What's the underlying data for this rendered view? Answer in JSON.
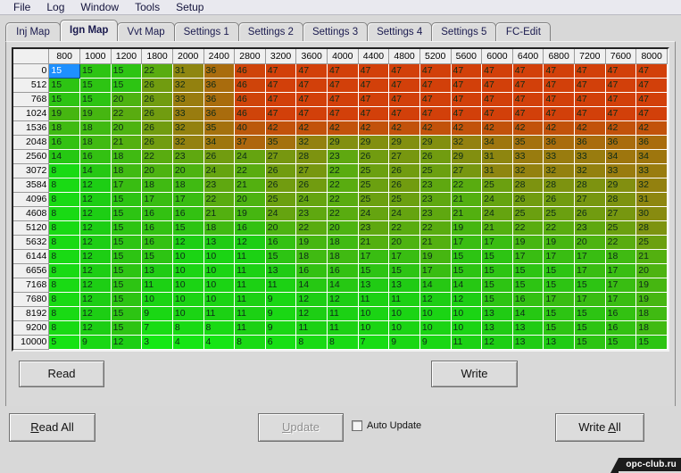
{
  "menu": {
    "items": [
      "File",
      "Log",
      "Window",
      "Tools",
      "Setup"
    ]
  },
  "tabs": [
    {
      "label": "Inj Map",
      "active": false
    },
    {
      "label": "Ign Map",
      "active": true
    },
    {
      "label": "Vvt Map",
      "active": false
    },
    {
      "label": "Settings 1",
      "active": false
    },
    {
      "label": "Settings 2",
      "active": false
    },
    {
      "label": "Settings 3",
      "active": false
    },
    {
      "label": "Settings 4",
      "active": false
    },
    {
      "label": "Settings 5",
      "active": false
    },
    {
      "label": "FC-Edit",
      "active": false
    }
  ],
  "colors": {
    "selection": "#1e90ff",
    "selection_text": "#ffffff",
    "low": "#00e000",
    "mid": "#8a8a10",
    "high": "#d2400a",
    "panel": "#d9d9d9"
  },
  "grid": {
    "corner_label": "",
    "column_headers": [
      "800",
      "1000",
      "1200",
      "1800",
      "2000",
      "2400",
      "2800",
      "3200",
      "3600",
      "4000",
      "4400",
      "4800",
      "5200",
      "5600",
      "6000",
      "6400",
      "6800",
      "7200",
      "7600",
      "8000"
    ],
    "row_headers": [
      "0",
      "512",
      "768",
      "1024",
      "1536",
      "2048",
      "2560",
      "3072",
      "3584",
      "4096",
      "4608",
      "5120",
      "5632",
      "6144",
      "6656",
      "7168",
      "7680",
      "8192",
      "9200",
      "10000"
    ],
    "selected_cell": {
      "row": 0,
      "col": 0,
      "value": "15"
    },
    "values": [
      [
        15,
        15,
        15,
        22,
        31,
        36,
        46,
        47,
        47,
        47,
        47,
        47,
        47,
        47,
        47,
        47,
        47,
        47,
        47,
        47
      ],
      [
        15,
        15,
        15,
        26,
        32,
        36,
        46,
        47,
        47,
        47,
        47,
        47,
        47,
        47,
        47,
        47,
        47,
        47,
        47,
        47
      ],
      [
        15,
        15,
        20,
        26,
        33,
        36,
        46,
        47,
        47,
        47,
        47,
        47,
        47,
        47,
        47,
        47,
        47,
        47,
        47,
        47
      ],
      [
        19,
        19,
        22,
        26,
        33,
        36,
        46,
        47,
        47,
        47,
        47,
        47,
        47,
        47,
        47,
        47,
        47,
        47,
        47,
        47
      ],
      [
        18,
        18,
        20,
        26,
        32,
        35,
        40,
        42,
        42,
        42,
        42,
        42,
        42,
        42,
        42,
        42,
        42,
        42,
        42,
        42
      ],
      [
        16,
        18,
        21,
        26,
        32,
        34,
        37,
        35,
        32,
        29,
        29,
        29,
        29,
        32,
        34,
        35,
        36,
        36,
        36,
        36
      ],
      [
        14,
        16,
        18,
        22,
        23,
        26,
        24,
        27,
        28,
        23,
        26,
        27,
        26,
        29,
        31,
        33,
        33,
        33,
        34,
        34
      ],
      [
        8,
        14,
        18,
        20,
        20,
        24,
        22,
        26,
        27,
        22,
        25,
        26,
        25,
        27,
        31,
        32,
        32,
        32,
        33,
        33
      ],
      [
        8,
        12,
        17,
        18,
        18,
        23,
        21,
        26,
        26,
        22,
        25,
        26,
        23,
        22,
        25,
        28,
        28,
        28,
        29,
        32
      ],
      [
        8,
        12,
        15,
        17,
        17,
        22,
        20,
        25,
        24,
        22,
        25,
        25,
        23,
        21,
        24,
        26,
        26,
        27,
        28,
        31
      ],
      [
        8,
        12,
        15,
        16,
        16,
        21,
        19,
        24,
        23,
        22,
        24,
        24,
        23,
        21,
        24,
        25,
        25,
        26,
        27,
        30
      ],
      [
        8,
        12,
        15,
        16,
        15,
        18,
        16,
        20,
        22,
        20,
        23,
        22,
        22,
        19,
        21,
        22,
        22,
        23,
        25,
        28
      ],
      [
        8,
        12,
        15,
        16,
        12,
        13,
        12,
        16,
        19,
        18,
        21,
        20,
        21,
        17,
        17,
        19,
        19,
        20,
        22,
        25
      ],
      [
        8,
        12,
        15,
        15,
        10,
        10,
        11,
        15,
        18,
        18,
        17,
        17,
        19,
        15,
        15,
        17,
        17,
        17,
        18,
        21
      ],
      [
        8,
        12,
        15,
        13,
        10,
        10,
        11,
        13,
        16,
        16,
        15,
        15,
        17,
        15,
        15,
        15,
        15,
        17,
        17,
        20
      ],
      [
        8,
        12,
        15,
        11,
        10,
        10,
        11,
        11,
        14,
        14,
        13,
        13,
        14,
        14,
        15,
        15,
        15,
        15,
        17,
        19
      ],
      [
        8,
        12,
        15,
        10,
        10,
        10,
        11,
        9,
        12,
        12,
        11,
        11,
        12,
        12,
        15,
        16,
        17,
        17,
        17,
        19
      ],
      [
        8,
        12,
        15,
        9,
        10,
        11,
        11,
        9,
        12,
        11,
        10,
        10,
        10,
        10,
        13,
        14,
        15,
        15,
        16,
        18
      ],
      [
        8,
        12,
        15,
        7,
        8,
        8,
        11,
        9,
        11,
        11,
        10,
        10,
        10,
        10,
        13,
        13,
        15,
        15,
        16,
        18
      ],
      [
        5,
        9,
        12,
        3,
        4,
        4,
        8,
        6,
        8,
        8,
        7,
        9,
        9,
        11,
        12,
        13,
        13,
        15,
        15,
        15
      ]
    ]
  },
  "inner_buttons": {
    "read": "Read",
    "write": "Write"
  },
  "bottom_bar": {
    "read_all": "Read All",
    "read_all_accel": "R",
    "update": "Update",
    "update_accel": "U",
    "update_disabled": true,
    "auto_update_label": "Auto Update",
    "auto_update_checked": false,
    "write_all": "Write All",
    "write_all_accel": "A"
  },
  "watermark": "opc-club.ru"
}
